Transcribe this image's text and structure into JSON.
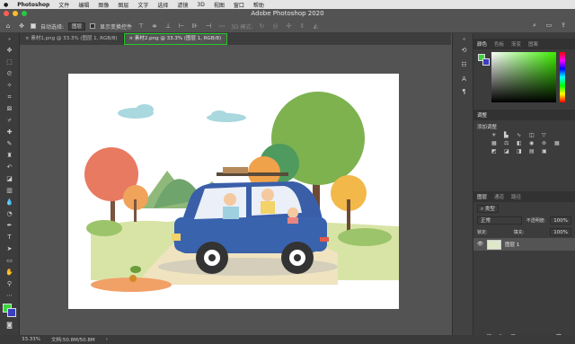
{
  "menubar": {
    "app_name": "Photoshop",
    "items": [
      "文件",
      "编辑",
      "图像",
      "图层",
      "文字",
      "选择",
      "滤镜",
      "3D",
      "视图",
      "窗口",
      "帮助"
    ]
  },
  "window": {
    "title": "Adobe Photoshop 2020"
  },
  "options": {
    "auto_select_label": "自动选择:",
    "auto_select_value": "图层",
    "show_transform_label": "显示变换控件",
    "mode_3d_label": "3D 模式:"
  },
  "tabs": [
    {
      "label": "素材1.png @ 33.3% (图层 1, RGB/8)",
      "active": false
    },
    {
      "label": "素材2.png @ 33.3% (图层 1, RGB/8)",
      "active": true
    }
  ],
  "colors": {
    "foreground": "#3a3fbf",
    "background": "#3a3fbf",
    "accent_green": "#26c826",
    "picker_hue": "#3cf000"
  },
  "color_panel": {
    "tabs": [
      "颜色",
      "色板",
      "渐变",
      "图案"
    ]
  },
  "adjustments_panel": {
    "tabs": [
      "调整"
    ],
    "add_label": "添加调整"
  },
  "layers_panel": {
    "tabs": [
      "图层",
      "通道",
      "路径"
    ],
    "kind_filter": "类型",
    "blend_mode": "正常",
    "opacity_label": "不透明度:",
    "opacity_value": "100%",
    "lock_label": "锁定:",
    "fill_label": "填充:",
    "fill_value": "100%",
    "layers": [
      {
        "name": "图层 1"
      }
    ]
  },
  "status": {
    "zoom": "33.33%",
    "doc_size": "文档:50.8M/50.8M"
  }
}
